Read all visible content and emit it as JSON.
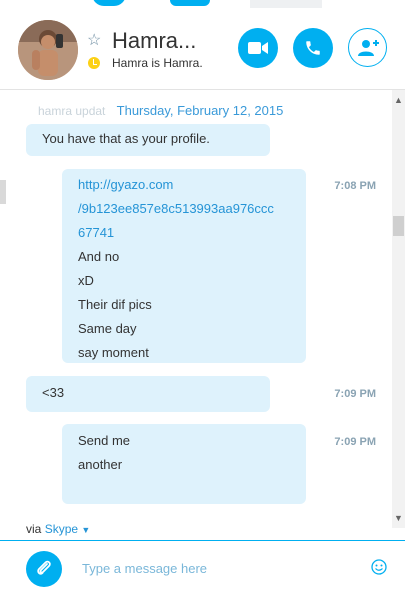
{
  "header": {
    "contact_name": "Hamra...",
    "mood": "Hamra is Hamra.",
    "icons": [
      "star-icon",
      "video-call-icon",
      "phone-icon",
      "add-person-icon"
    ],
    "accent": "#00aff0"
  },
  "chat": {
    "ghost_text": "hamra updat",
    "date": "Thursday, February 12, 2015",
    "messages": [
      {
        "lines": [
          "You have that as your profile."
        ],
        "time": ""
      },
      {
        "lines": [
          "http://gyazo.com",
          "/9b123ee857e8c513993aa976ccc",
          "67741",
          "And no",
          "xD",
          "Their dif pics",
          "Same day",
          "say moment"
        ],
        "time": "7:08 PM"
      },
      {
        "lines": [
          "<33"
        ],
        "time": "7:09 PM"
      },
      {
        "lines": [
          "Send me",
          "another"
        ],
        "time": "7:09 PM"
      }
    ]
  },
  "footer": {
    "via": "via",
    "via_service": "Skype",
    "placeholder": "Type a message here"
  }
}
